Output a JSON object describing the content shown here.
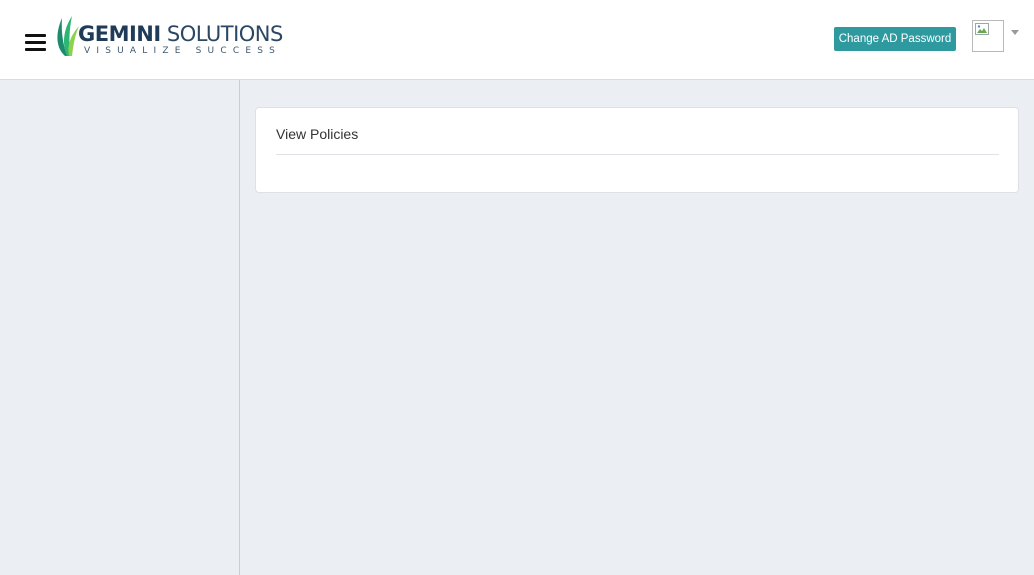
{
  "header": {
    "logo": {
      "name_bold": "GEMINI",
      "name_light": "SOLUTIONS",
      "tagline": "VISUALIZE SUCCESS"
    },
    "change_password_label": "Change AD Password"
  },
  "main": {
    "card": {
      "title": "View Policies"
    }
  },
  "colors": {
    "accent": "#2e9aa0",
    "background": "#ebeef2",
    "logo_text": "#1f3b57"
  },
  "icons": {
    "menu": "hamburger-menu-icon",
    "avatar": "broken-image-icon",
    "dropdown": "caret-down-icon"
  }
}
